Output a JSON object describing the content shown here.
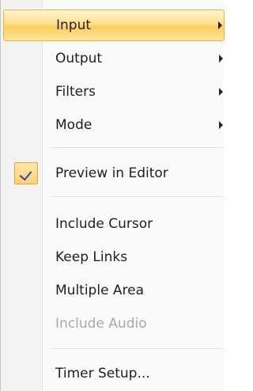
{
  "menu": {
    "items": [
      {
        "label": "Input",
        "has_submenu": true,
        "highlighted": true
      },
      {
        "label": "Output",
        "has_submenu": true
      },
      {
        "label": "Filters",
        "has_submenu": true
      },
      {
        "label": "Mode",
        "has_submenu": true
      },
      {
        "label": "Preview in Editor",
        "checked": true
      },
      {
        "label": "Include Cursor"
      },
      {
        "label": "Keep Links"
      },
      {
        "label": "Multiple Area"
      },
      {
        "label": "Include Audio",
        "disabled": true
      },
      {
        "label": "Timer Setup..."
      }
    ],
    "icons": {
      "submenu_arrow": "chevron-right-icon",
      "checkmark": "checkmark-icon"
    },
    "colors": {
      "highlight": "#fbcf5c",
      "disabled_text": "#a8a8a8",
      "checkmark": "#1c4fa3"
    }
  }
}
